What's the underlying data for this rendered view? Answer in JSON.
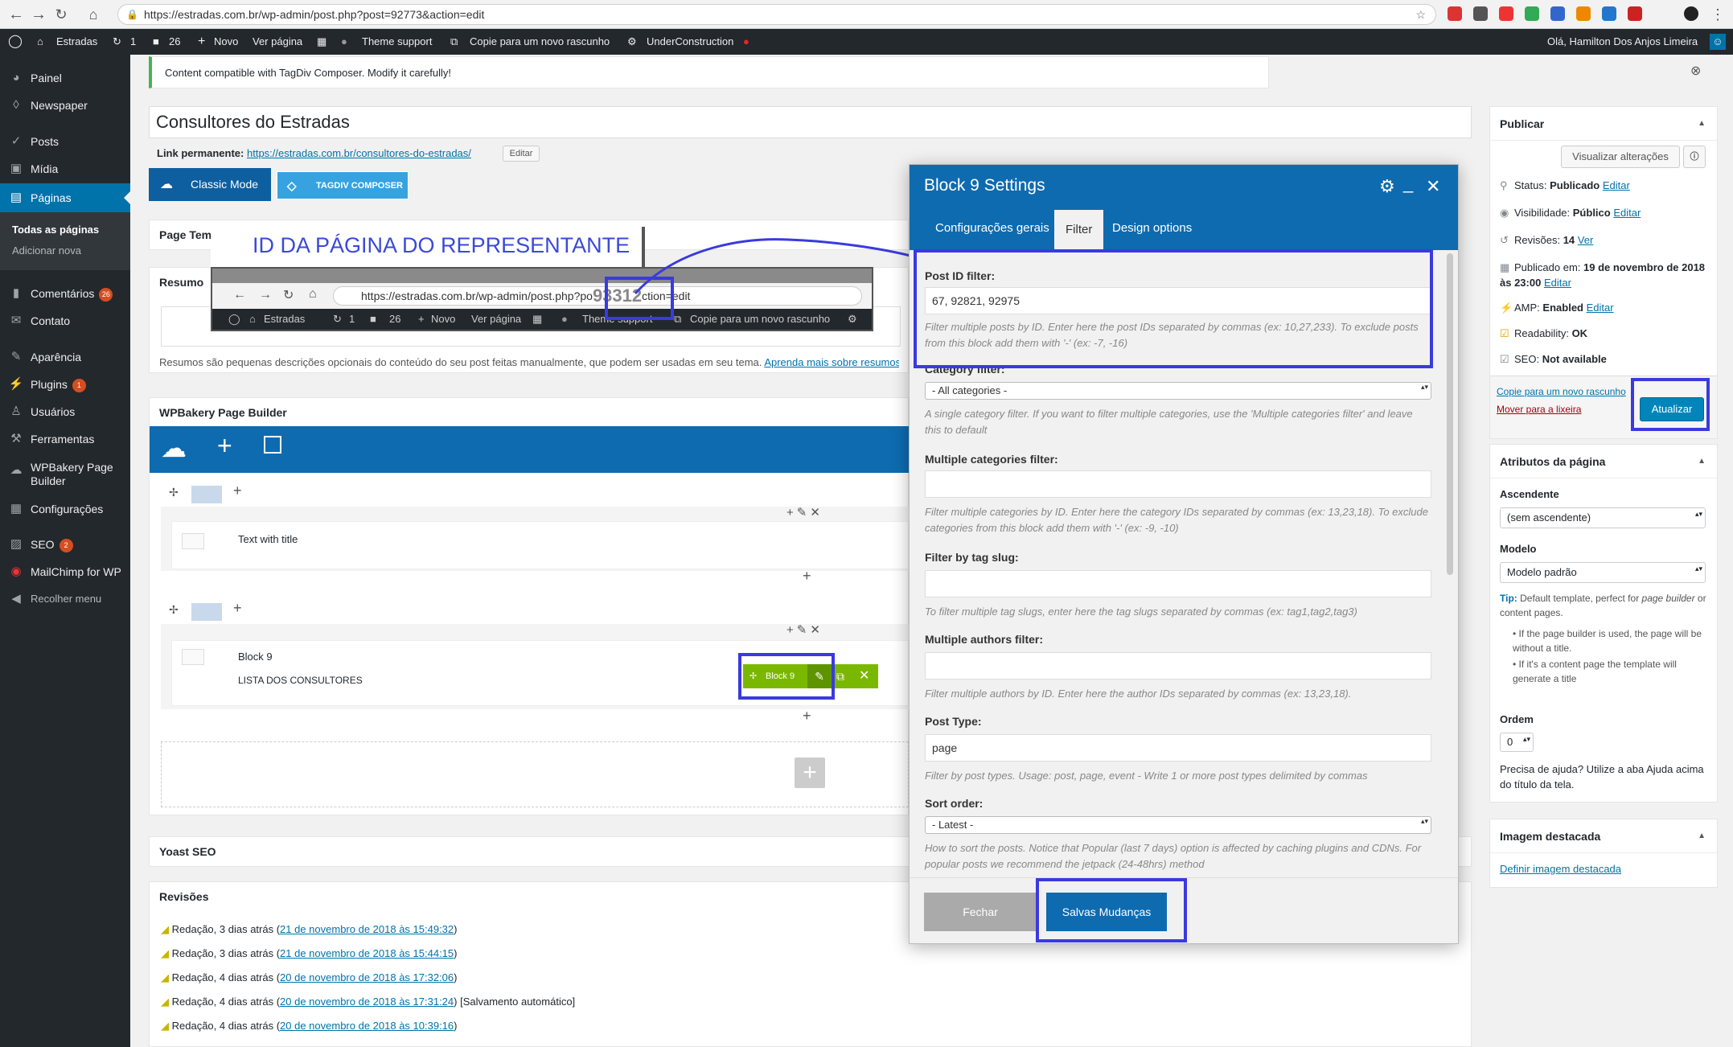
{
  "browser": {
    "url": "https://estradas.com.br/wp-admin/post.php?post=92773&action=edit"
  },
  "adminbar": {
    "site": "Estradas",
    "updates": "1",
    "comments": "26",
    "new": "Novo",
    "view_page": "Ver página",
    "theme_support": "Theme support",
    "copy_draft": "Copie para um novo rascunho",
    "under_construction": "UnderConstruction",
    "greeting": "Olá, Hamilton Dos Anjos Limeira"
  },
  "sidebar": {
    "items": [
      {
        "label": "Painel",
        "icon": "dashboard-icon"
      },
      {
        "label": "Newspaper",
        "icon": "newspaper-icon"
      },
      {
        "label": "Posts",
        "icon": "pin-icon"
      },
      {
        "label": "Mídia",
        "icon": "media-icon"
      },
      {
        "label": "Páginas",
        "icon": "pages-icon"
      },
      {
        "label": "Comentários",
        "icon": "comments-icon",
        "count": "26"
      },
      {
        "label": "Contato",
        "icon": "mail-icon"
      },
      {
        "label": "Aparência",
        "icon": "brush-icon"
      },
      {
        "label": "Plugins",
        "icon": "plugin-icon",
        "count": "1"
      },
      {
        "label": "Usuários",
        "icon": "users-icon"
      },
      {
        "label": "Ferramentas",
        "icon": "tools-icon"
      },
      {
        "label": "WPBakery Page Builder",
        "icon": "cloud-icon"
      },
      {
        "label": "Configurações",
        "icon": "settings-icon"
      },
      {
        "label": "SEO",
        "icon": "seo-icon",
        "count": "2"
      },
      {
        "label": "MailChimp for WP",
        "icon": "mailchimp-icon"
      },
      {
        "label": "Recolher menu",
        "icon": "collapse-icon"
      }
    ],
    "sub_all": "Todas as páginas",
    "sub_add": "Adicionar nova"
  },
  "notice": "Content compatible with TagDiv Composer. Modify it carefully!",
  "post": {
    "title": "Consultores do Estradas",
    "permalink_label": "Link permanente:",
    "permalink": "https://estradas.com.br/consultores-do-estradas/",
    "edit_btn": "Editar"
  },
  "modes": {
    "classic": "Classic Mode",
    "tagdiv": "TAGDIV COMPOSER"
  },
  "page_template_label": "Page Tem",
  "summary": {
    "title": "Resumo",
    "help": "Resumos são pequenas descrições opcionais do conteúdo do seu post feitas manualmente, que podem ser usadas em seu tema.",
    "link": "Aprenda mais sobre resumos"
  },
  "overlay": {
    "caption": "ID DA PÁGINA DO REPRESENTANTE",
    "url_prefix": "https://estradas.com.br/wp-admin/post.php?po",
    "id": "93312",
    "url_suffix": "ction=edit",
    "bar_site": "Estradas",
    "bar_updates": "1",
    "bar_comments": "26",
    "bar_new": "Novo",
    "bar_view": "Ver página",
    "bar_theme": "Theme support",
    "bar_copy": "Copie para um novo rascunho"
  },
  "builder": {
    "title": "WPBakery Page Builder",
    "el1": "Text with title",
    "el2_title": "Block 9",
    "el2_sub": "LISTA DOS CONSULTORES",
    "chip": "Block 9"
  },
  "yoast": "Yoast SEO",
  "revisions": {
    "title": "Revisões",
    "items": [
      {
        "prefix": "Redação, 3 dias atrás (",
        "link": "21 de novembro de 2018 às 15:49:32",
        "suffix": ")"
      },
      {
        "prefix": "Redação, 3 dias atrás (",
        "link": "21 de novembro de 2018 às 15:44:15",
        "suffix": ")"
      },
      {
        "prefix": "Redação, 4 dias atrás (",
        "link": "20 de novembro de 2018 às 17:32:06",
        "suffix": ")"
      },
      {
        "prefix": "Redação, 4 dias atrás (",
        "link": "20 de novembro de 2018 às 17:31:24",
        "suffix": ") [Salvamento automático]"
      },
      {
        "prefix": "Redação, 4 dias atrás (",
        "link": "20 de novembro de 2018 às 10:39:16",
        "suffix": ")"
      }
    ]
  },
  "modal": {
    "title": "Block 9 Settings",
    "tabs": [
      "Configurações gerais",
      "Filter",
      "Design options"
    ],
    "post_id_label": "Post ID filter:",
    "post_id_value": "67, 92821, 92975",
    "post_id_desc": "Filter multiple posts by ID. Enter here the post IDs separated by commas (ex: 10,27,233). To exclude posts from this block add them with '-' (ex: -7, -16)",
    "category_label": "Category filter:",
    "category_value": "- All categories -",
    "category_desc": "A single category filter. If you want to filter multiple categories, use the 'Multiple categories filter' and leave this to default",
    "multi_cat_label": "Multiple categories filter:",
    "multi_cat_desc": "Filter multiple categories by ID. Enter here the category IDs separated by commas (ex: 13,23,18). To exclude categories from this block add them with '-' (ex: -9, -10)",
    "tag_label": "Filter by tag slug:",
    "tag_desc": "To filter multiple tag slugs, enter here the tag slugs separated by commas (ex: tag1,tag2,tag3)",
    "authors_label": "Multiple authors filter:",
    "authors_desc": "Filter multiple authors by ID. Enter here the author IDs separated by commas (ex: 13,23,18).",
    "post_type_label": "Post Type:",
    "post_type_value": "page",
    "post_type_desc": "Filter by post types. Usage: post, page, event - Write 1 or more post types delimited by commas",
    "sort_label": "Sort order:",
    "sort_value": "- Latest -",
    "sort_desc": "How to sort the posts. Notice that Popular (last 7 days) option is affected by caching plugins and CDNs. For popular posts we recommend the jetpack (24-48hrs) method",
    "close_btn": "Fechar",
    "save_btn": "Salvas Mudanças"
  },
  "publish": {
    "title": "Publicar",
    "preview": "Visualizar alterações",
    "status_label": "Status:",
    "status": "Publicado",
    "visibility_label": "Visibilidade:",
    "visibility": "Público",
    "revisions_label": "Revisões:",
    "revisions": "14",
    "revisions_link": "Ver",
    "published_label": "Publicado em:",
    "published": "19 de novembro de 2018 às 23:00",
    "amp_label": "AMP:",
    "amp": "Enabled",
    "readability_label": "Readability:",
    "readability": "OK",
    "seo_label": "SEO:",
    "seo": "Not available",
    "edit": "Editar",
    "copy": "Copie para um novo rascunho",
    "trash": "Mover para a lixeira",
    "update": "Atualizar"
  },
  "attributes": {
    "title": "Atributos da página",
    "parent_label": "Ascendente",
    "parent_value": "(sem ascendente)",
    "model_label": "Modelo",
    "model_value": "Modelo padrão",
    "tip_label": "Tip:",
    "tip_text_1": " Default template, perfect for ",
    "tip_em_1": "page builder",
    "tip_text_2": " or content pages.",
    "bullet1": "If the page builder is used, the page will be without a title.",
    "bullet2": "If it's a content page the template will generate a title",
    "order_label": "Ordem",
    "order_value": "0",
    "help": "Precisa de ajuda? Utilize a aba Ajuda acima do título da tela."
  },
  "featured": {
    "title": "Imagem destacada",
    "link": "Definir imagem destacada"
  }
}
